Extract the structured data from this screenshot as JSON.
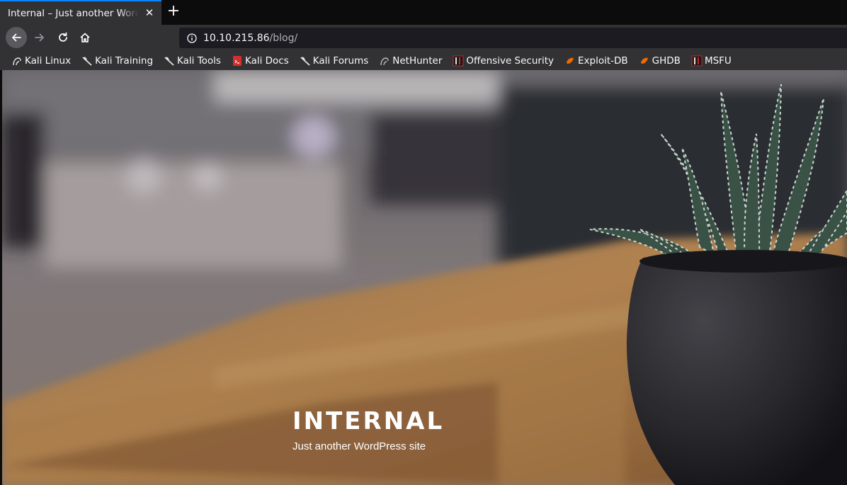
{
  "tab": {
    "title": "Internal – Just another WordPress site",
    "close": "✕",
    "new_tab": "+"
  },
  "nav": {
    "url_host": "10.10.215.86",
    "url_path": "/blog/"
  },
  "bookmarks": [
    {
      "label": "Kali Linux",
      "icon": "kali-dragon-icon"
    },
    {
      "label": "Kali Training",
      "icon": "kali-dragon-icon"
    },
    {
      "label": "Kali Tools",
      "icon": "kali-dragon-icon"
    },
    {
      "label": "Kali Docs",
      "icon": "kali-docs-icon"
    },
    {
      "label": "Kali Forums",
      "icon": "kali-dragon-icon"
    },
    {
      "label": "NetHunter",
      "icon": "nethunter-icon"
    },
    {
      "label": "Offensive Security",
      "icon": "offsec-icon"
    },
    {
      "label": "Exploit-DB",
      "icon": "exploitdb-icon"
    },
    {
      "label": "GHDB",
      "icon": "exploitdb-icon"
    },
    {
      "label": "MSFU",
      "icon": "offsec-icon"
    }
  ],
  "site": {
    "title": "INTERNAL",
    "tagline": "Just another WordPress site"
  },
  "colors": {
    "tab_accent": "#0a84ff",
    "chrome": "#323234",
    "urlbar": "#1c1b22"
  }
}
